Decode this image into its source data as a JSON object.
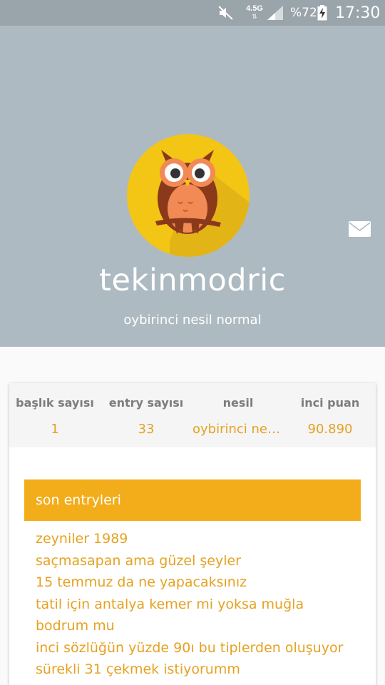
{
  "status_bar": {
    "network": "4.5G",
    "battery_percent": "%72",
    "time": "17:30",
    "icons": [
      "mute-icon",
      "network-data-icon",
      "signal-icon",
      "battery-charging-icon"
    ]
  },
  "profile": {
    "username": "tekinmodric",
    "subtitle": "oybirinci nesil normal",
    "avatar_icon": "owl-avatar-icon",
    "mail_icon": "mail-icon"
  },
  "stats": [
    {
      "label": "başlık sayısı",
      "value": "1"
    },
    {
      "label": "entry sayısı",
      "value": "33"
    },
    {
      "label": "nesil",
      "value": "oybirinci nesi..."
    },
    {
      "label": "inci puan",
      "value": "90.890"
    }
  ],
  "recent_entries": {
    "title": "son entryleri",
    "items": [
      "zeyniler 1989",
      "saçmasapan ama güzel şeyler",
      "15 temmuz da ne yapacaksınız",
      "tatil için antalya kemer mi yoksa muğla bodrum mu",
      "inci sözlüğün yüzde 90ı bu tiplerden oluşuyor",
      "sürekli 31 çekmek istiyorumm"
    ]
  },
  "colors": {
    "header_bg": "#adbac2",
    "accent": "#f3ad1a",
    "link": "#e5a222",
    "avatar_circle": "#f3c515"
  }
}
